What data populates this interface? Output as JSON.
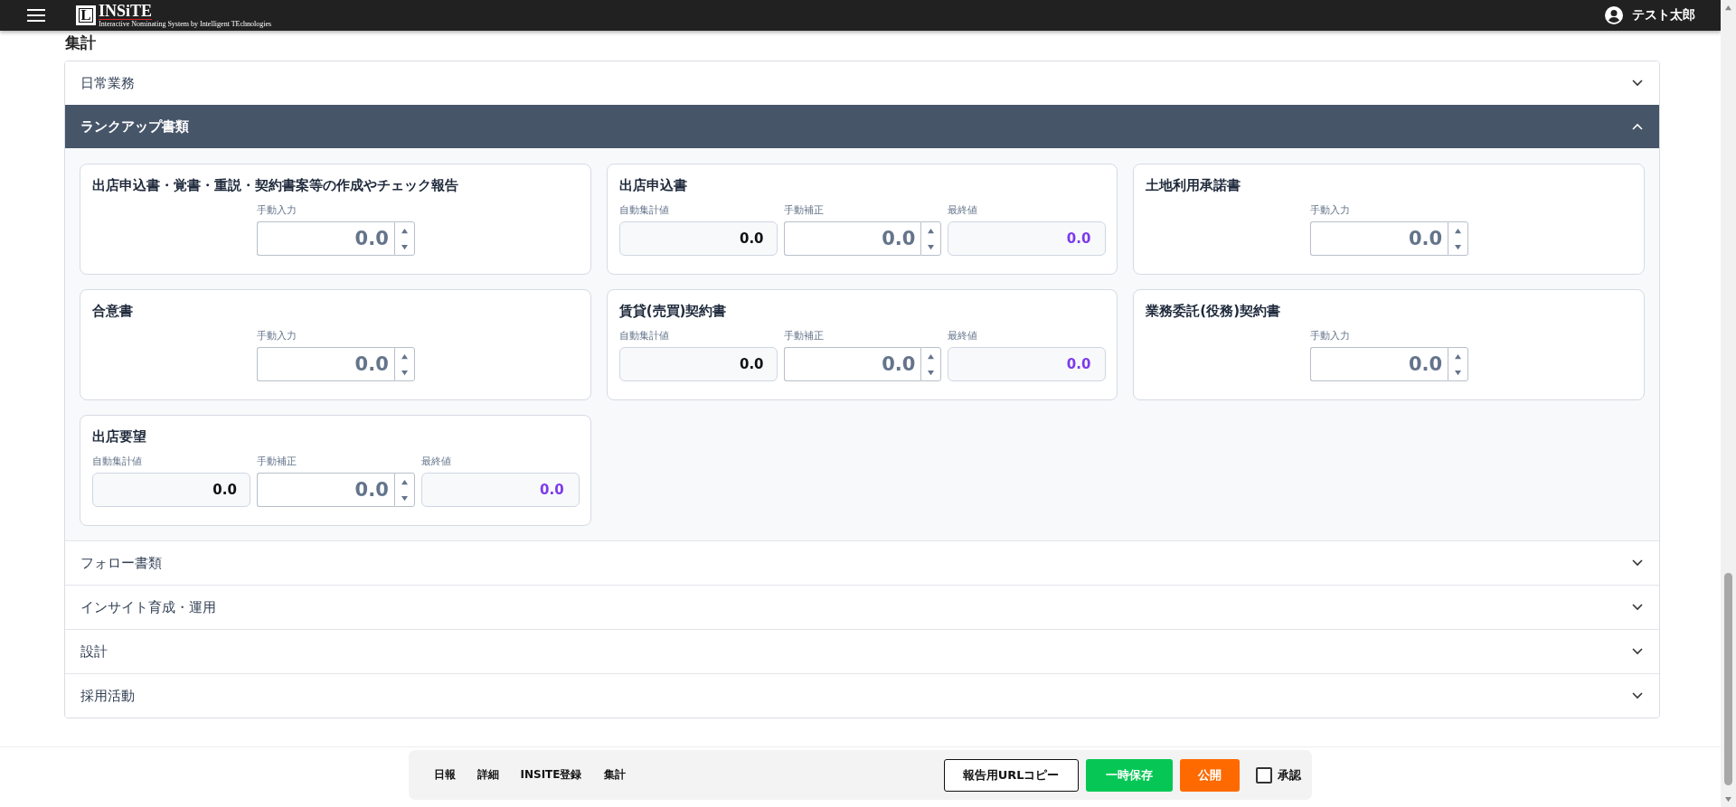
{
  "header": {
    "logo": {
      "mark": "L",
      "name": "INSiTE",
      "tagline": "Interactive Nominating System by Intelligent TEchnologies"
    },
    "user": "テスト太郎"
  },
  "page_title": "集計",
  "sections": [
    {
      "title": "日常業務",
      "expanded": false
    },
    {
      "title": "ランクアップ書類",
      "expanded": true,
      "cards": [
        {
          "title": "出店申込書・覚書・重説・契約書案等の作成やチェック報告",
          "kind": "manual",
          "fields": [
            {
              "label": "手動入力",
              "value": "0.0",
              "kind": "spinner"
            }
          ]
        },
        {
          "title": "出店申込書",
          "kind": "computed",
          "fields": [
            {
              "label": "自動集計値",
              "value": "0.0",
              "kind": "auto"
            },
            {
              "label": "手動補正",
              "value": "0.0",
              "kind": "spinner"
            },
            {
              "label": "最終値",
              "value": "0.0",
              "kind": "final"
            }
          ]
        },
        {
          "title": "土地利用承諾書",
          "kind": "manual",
          "fields": [
            {
              "label": "手動入力",
              "value": "0.0",
              "kind": "spinner"
            }
          ]
        },
        {
          "title": "合意書",
          "kind": "manual",
          "fields": [
            {
              "label": "手動入力",
              "value": "0.0",
              "kind": "spinner"
            }
          ]
        },
        {
          "title": "賃貸(売買)契約書",
          "kind": "computed",
          "fields": [
            {
              "label": "自動集計値",
              "value": "0.0",
              "kind": "auto"
            },
            {
              "label": "手動補正",
              "value": "0.0",
              "kind": "spinner"
            },
            {
              "label": "最終値",
              "value": "0.0",
              "kind": "final"
            }
          ]
        },
        {
          "title": "業務委託(役務)契約書",
          "kind": "manual",
          "fields": [
            {
              "label": "手動入力",
              "value": "0.0",
              "kind": "spinner"
            }
          ]
        },
        {
          "title": "出店要望",
          "kind": "computed",
          "fields": [
            {
              "label": "自動集計値",
              "value": "0.0",
              "kind": "auto"
            },
            {
              "label": "手動補正",
              "value": "0.0",
              "kind": "spinner"
            },
            {
              "label": "最終値",
              "value": "0.0",
              "kind": "final"
            }
          ]
        }
      ]
    },
    {
      "title": "フォロー書類",
      "expanded": false
    },
    {
      "title": "インサイト育成・運用",
      "expanded": false
    },
    {
      "title": "設計",
      "expanded": false
    },
    {
      "title": "採用活動",
      "expanded": false
    }
  ],
  "footer": {
    "nav": [
      "日報",
      "詳細",
      "INSITE登録",
      "集計"
    ],
    "buttons": [
      {
        "label": "報告用URLコピー",
        "kind": "outline"
      },
      {
        "label": "一時保存",
        "kind": "save"
      },
      {
        "label": "公開",
        "kind": "publish"
      }
    ],
    "approve": {
      "label": "承認",
      "checked": false
    }
  }
}
